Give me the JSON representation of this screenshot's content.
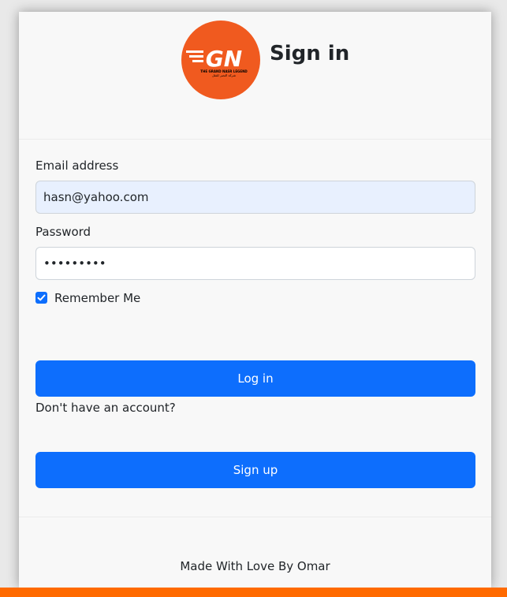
{
  "header": {
    "title": "Sign in",
    "logo": {
      "initials": "GN",
      "tagline": "THE GRAND NASR LEGEND",
      "arabic": "شركة النصر للنقل",
      "color": "#f05a1f"
    }
  },
  "form": {
    "email_label": "Email address",
    "email_value": "hasn@yahoo.com",
    "password_label": "Password",
    "password_value": "123456789",
    "remember_label": "Remember Me",
    "remember_checked": true,
    "login_label": "Log in",
    "no_account_text": "Don't have an account?",
    "signup_label": "Sign up"
  },
  "footer": {
    "text": "Made With Love By Omar"
  },
  "colors": {
    "primary": "#0d6efd",
    "accent_bar": "#ff6a00"
  }
}
